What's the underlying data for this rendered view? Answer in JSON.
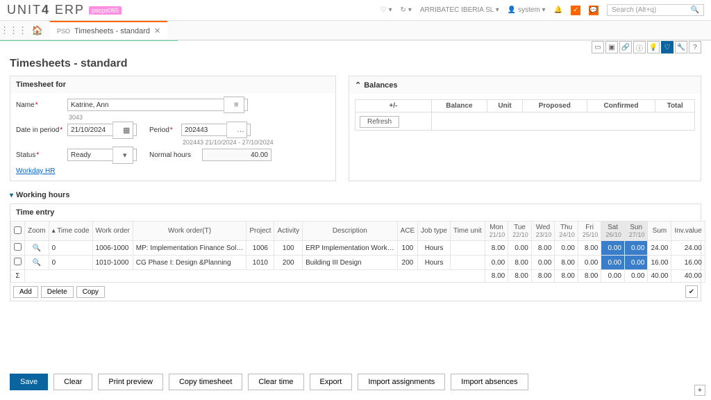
{
  "brand": {
    "name1": "UNIT",
    "name2": "4",
    "suffix": "ERP",
    "env": "psops065"
  },
  "top": {
    "company": "ARRIBATEC IBERIA SL",
    "user": "system",
    "search_placeholder": "Search (Alt+q)"
  },
  "tabs": {
    "prefix": "PSO",
    "title": "Timesheets - standard"
  },
  "page_title": "Timesheets - standard",
  "form": {
    "panel_title": "Timesheet for",
    "name_label": "Name",
    "name_value": "Katrine, Ann",
    "name_code": "3043",
    "date_label": "Date in period",
    "date_value": "21/10/2024",
    "period_label": "Period",
    "period_value": "202443",
    "period_range": "202443 21/10/2024 - 27/10/2024",
    "status_label": "Status",
    "status_value": "Ready",
    "normal_label": "Normal hours",
    "normal_value": "40.00",
    "workday_link": "Workday HR"
  },
  "balances": {
    "title": "Balances",
    "cols": [
      "+/-",
      "Balance",
      "Unit",
      "Proposed",
      "Confirmed",
      "Total"
    ],
    "refresh": "Refresh"
  },
  "working_hours": "Working hours",
  "time_entry": {
    "title": "Time entry",
    "cols": [
      "",
      "Zoom",
      "Time code",
      "Work order",
      "Work order(T)",
      "Project",
      "Activity",
      "Description",
      "ACE",
      "Job type",
      "Time unit",
      "Mon",
      "Tue",
      "Wed",
      "Thu",
      "Fri",
      "Sat",
      "Sun",
      "Sum",
      "Inv.value"
    ],
    "day_dates": [
      "21/10",
      "22/10",
      "23/10",
      "24/10",
      "25/10",
      "26/10",
      "27/10"
    ],
    "rows": [
      {
        "code": "0",
        "wo": "1006-1000",
        "wot": "MP: Implementation Finance Sol…",
        "project": "1006",
        "activity": "100",
        "desc": "ERP Implementation Work…",
        "ace": "100",
        "job": "Hours",
        "days": [
          "8.00",
          "0.00",
          "8.00",
          "0.00",
          "8.00",
          "0.00",
          "0.00"
        ],
        "sum": "24.00",
        "inv": "24.00"
      },
      {
        "code": "0",
        "wo": "1010-1000",
        "wot": "CG Phase I: Design &Planning",
        "project": "1010",
        "activity": "200",
        "desc": "Building III Design",
        "ace": "200",
        "job": "Hours",
        "days": [
          "0.00",
          "8.00",
          "0.00",
          "8.00",
          "0.00",
          "0.00",
          "0.00"
        ],
        "sum": "16.00",
        "inv": "16.00"
      }
    ],
    "totals": {
      "days": [
        "8.00",
        "8.00",
        "8.00",
        "8.00",
        "8.00",
        "0.00",
        "0.00"
      ],
      "sum": "40.00",
      "inv": "40.00"
    },
    "add": "Add",
    "delete": "Delete",
    "copy": "Copy"
  },
  "footer": {
    "save": "Save",
    "clear": "Clear",
    "print": "Print preview",
    "copy_ts": "Copy timesheet",
    "clear_time": "Clear time",
    "export": "Export",
    "import_a": "Import assignments",
    "import_ab": "Import absences"
  },
  "sigma": "Σ"
}
